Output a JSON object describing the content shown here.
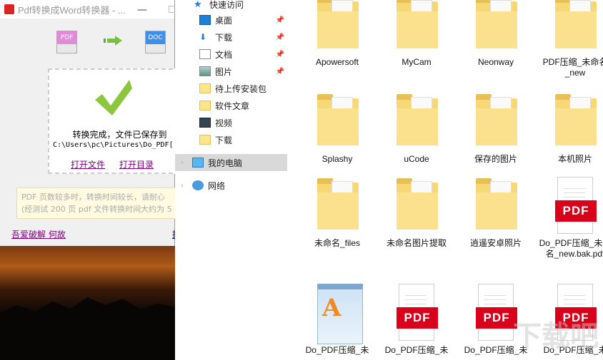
{
  "app": {
    "title": "Pdf转换成Word转换器 - ...",
    "minimize": "—",
    "from_format": "PDF",
    "to_format": "DOC",
    "status": "转换完成，文件已保存到",
    "path": "C:\\Users\\pc\\Pictures\\Do_PDF[",
    "open_file": "打开文件",
    "open_folder": "打开目录",
    "note_line1": "PDF 页数较多时，转换时间较长，请耐心",
    "note_line2": "(经测试 200 页 pdf 文件转换时间大约为 5",
    "footer_link": "吾爱破解 何故",
    "footer_link2": "提"
  },
  "nav": {
    "quick_access": "快速访问",
    "items": [
      {
        "label": "桌面",
        "icon": "desktop-icon",
        "pinned": true
      },
      {
        "label": "下载",
        "icon": "download-icon",
        "pinned": true
      },
      {
        "label": "文档",
        "icon": "document-icon",
        "pinned": true
      },
      {
        "label": "图片",
        "icon": "pictures-icon",
        "pinned": true
      },
      {
        "label": "待上传安装包",
        "icon": "folder-icon"
      },
      {
        "label": "软件文章",
        "icon": "folder-icon"
      },
      {
        "label": "视频",
        "icon": "video-icon"
      },
      {
        "label": "下载",
        "icon": "folder-icon"
      }
    ],
    "this_pc": "我的电脑",
    "network": "网络"
  },
  "files": [
    {
      "name": "Apowersoft",
      "type": "folder"
    },
    {
      "name": "MyCam",
      "type": "folder"
    },
    {
      "name": "Neonway",
      "type": "folder"
    },
    {
      "name": "PDF压缩_未命名_new",
      "type": "folder"
    },
    {
      "name": "Splashy",
      "type": "folder"
    },
    {
      "name": "uCode",
      "type": "folder"
    },
    {
      "name": "保存的图片",
      "type": "folder"
    },
    {
      "name": "本机照片",
      "type": "folder"
    },
    {
      "name": "未命名_files",
      "type": "folder"
    },
    {
      "name": "未命名图片提取",
      "type": "folder"
    },
    {
      "name": "逍遥安卓照片",
      "type": "folder"
    },
    {
      "name": "Do_PDF压缩_未命名_new.bak.pdf",
      "type": "pdf"
    },
    {
      "name": "Do_PDF压缩_未",
      "type": "wordpad"
    },
    {
      "name": "Do_PDF压缩_未",
      "type": "pdf"
    },
    {
      "name": "Do_PDF压缩_未",
      "type": "pdf"
    },
    {
      "name": "Do_PDF压缩_未",
      "type": "pdf"
    }
  ],
  "pdf_badge": "PDF",
  "wordpad_glyph": "A",
  "watermark": "下载吧"
}
